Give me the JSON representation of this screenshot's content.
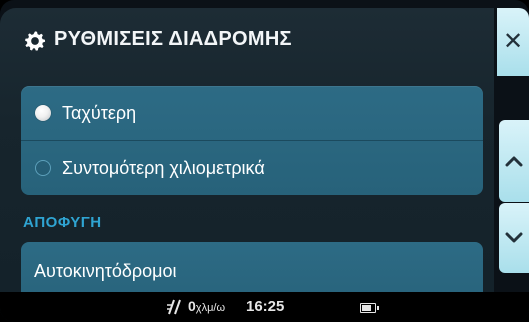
{
  "header": {
    "title": "ΡΥΘΜΙΣΕΙΣ ΔΙΑΔΡΟΜΗΣ",
    "icon": "gear-icon"
  },
  "route_options": [
    {
      "label": "Ταχύτερη",
      "selected": true
    },
    {
      "label": "Συντομότερη χιλιομετρικά",
      "selected": false
    }
  ],
  "avoid_section": {
    "title": "ΑΠΟΦΥΓΗ",
    "items": [
      {
        "label": "Αυτοκινητόδρομοι"
      }
    ]
  },
  "side_buttons": {
    "close": "close-icon",
    "scroll_up": "chevron-up-icon",
    "scroll_down": "chevron-down-icon"
  },
  "status_bar": {
    "speed_value": "0",
    "speed_unit": "χλμ/ω",
    "time": "16:25",
    "battery_level": 0.75
  },
  "colors": {
    "panel": "#17252d",
    "row": "#2b6781",
    "accent": "#2fa4d2",
    "side_button": "#c4ebf4"
  }
}
